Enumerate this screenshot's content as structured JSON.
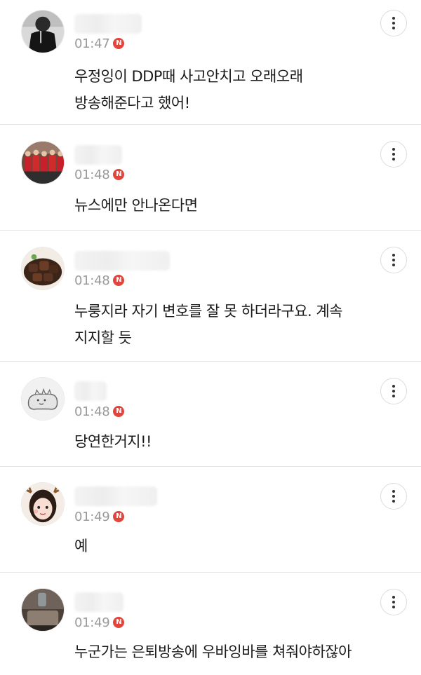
{
  "comments": [
    {
      "avatar_icon": "avatar-person-black-top",
      "time": "01:47",
      "new_badge": "N",
      "text": "우정잉이 DDP때 사고안치고 오래오래\n방송해준다고 했어!",
      "more_icon": "more-vertical-icon"
    },
    {
      "avatar_icon": "avatar-red-team-group",
      "time": "01:48",
      "new_badge": "N",
      "text": "뉴스에만 안나온다면",
      "more_icon": "more-vertical-icon"
    },
    {
      "avatar_icon": "avatar-food-steak",
      "time": "01:48",
      "new_badge": "N",
      "text": "누룽지라 자기 변호를 잘 못 하더라구요. 계속\n지지할 듯",
      "more_icon": "more-vertical-icon"
    },
    {
      "avatar_icon": "avatar-default-character",
      "time": "01:48",
      "new_badge": "N",
      "text": "당연한거지!!",
      "more_icon": "more-vertical-icon"
    },
    {
      "avatar_icon": "avatar-girl-reindeer",
      "time": "01:49",
      "new_badge": "N",
      "text": "예",
      "more_icon": "more-vertical-icon"
    },
    {
      "avatar_icon": "avatar-dark-photo",
      "time": "01:49",
      "new_badge": "N",
      "text": "누군가는 은퇴방송에 우바잉바를 쳐줘야하잖아",
      "more_icon": "more-vertical-icon"
    }
  ],
  "colors": {
    "time_gray": "#9a9a9a",
    "badge_red": "#e2453c",
    "divider": "#e6e6e6"
  }
}
